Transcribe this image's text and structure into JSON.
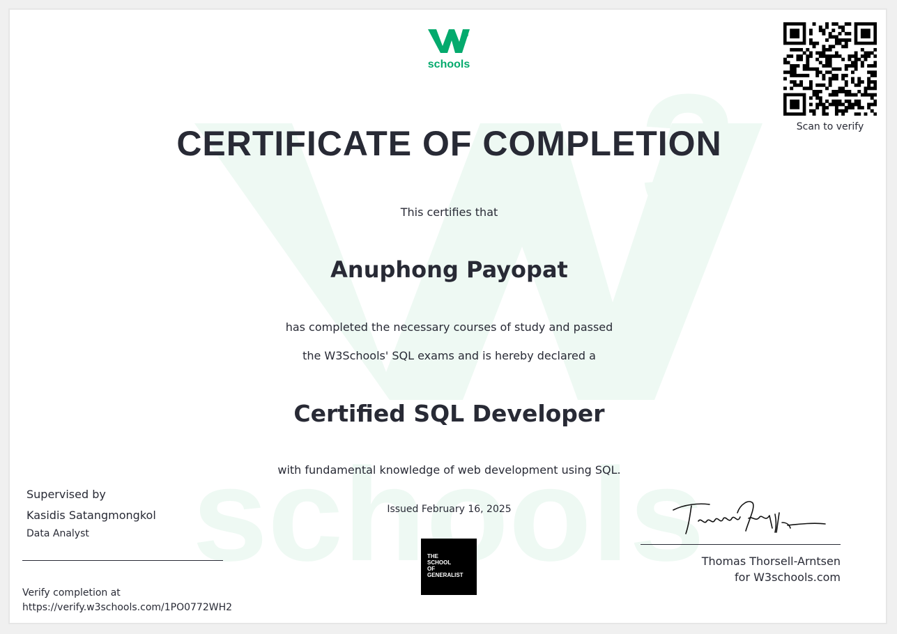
{
  "logo": {
    "icon": "w3schools-logo-icon",
    "mark": "W",
    "superscript": "3",
    "wordmark": "schools",
    "color": "#04aa6d"
  },
  "watermark": {
    "mark": "W",
    "superscript": "3",
    "word": "schools",
    "color": "#e7f6ee"
  },
  "qr": {
    "icon": "qr-code-icon",
    "label": "Scan to verify"
  },
  "certificate": {
    "title": "CERTIFICATE OF COMPLETION",
    "intro": "This certifies that",
    "recipient": "Anuphong Payopat",
    "statement_line1": "has completed the necessary courses of study and passed",
    "statement_line2": "the W3Schools' SQL exams and is hereby declared a",
    "designation": "Certified SQL Developer",
    "statement_line3": "with fundamental knowledge of web development using SQL.",
    "issued": "Issued February 16, 2025"
  },
  "badge": {
    "icon": "school-of-generalist-logo-icon",
    "lines": [
      "THE",
      "SCHOOL",
      "OF",
      "GENERALIST"
    ]
  },
  "supervisor": {
    "label": "Supervised by",
    "name": "Kasidis Satangmongkol",
    "title": "Data Analyst"
  },
  "verification": {
    "label": "Verify completion at",
    "url": "https://verify.w3schools.com/1PO0772WH2"
  },
  "signatory": {
    "signature_icon": "handwritten-signature-icon",
    "signature_text": "Thomas Thorsell-Arntsen",
    "name": "Thomas Thorsell-Arntsen",
    "organization": "for W3schools.com"
  },
  "colors": {
    "brand_green": "#04aa6d",
    "text_dark": "#282a35"
  }
}
